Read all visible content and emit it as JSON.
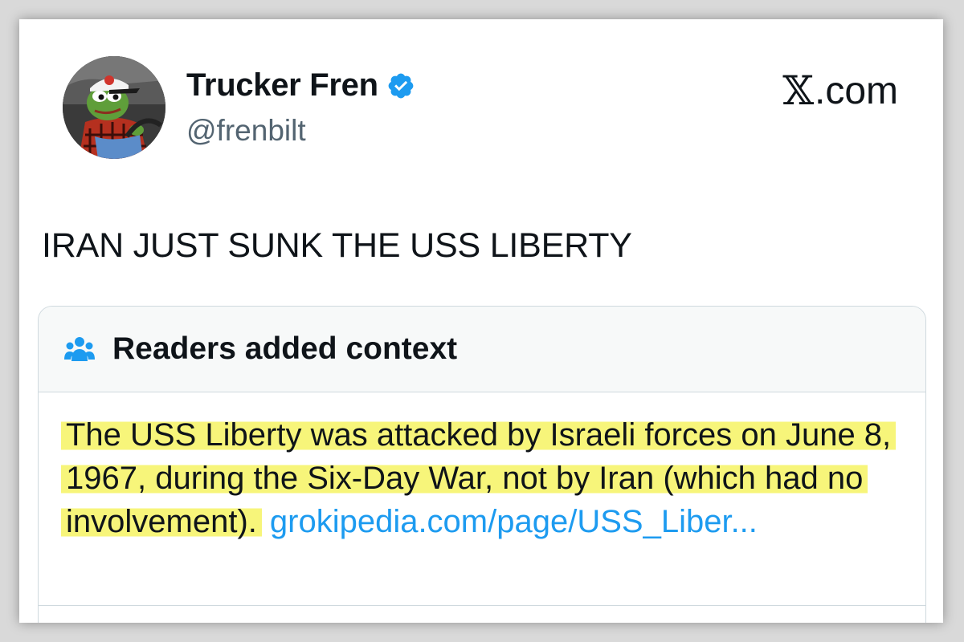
{
  "author": {
    "display_name": "Trucker Fren",
    "handle": "@frenbilt",
    "verified": true
  },
  "brand": {
    "glyph": "𝕏",
    "label": ".com"
  },
  "post": {
    "text": "IRAN JUST SUNK THE USS LIBERTY"
  },
  "community_note": {
    "title": "Readers added context",
    "body": "The USS Liberty was attacked by Israeli forces on June 8, 1967, during the Six-Day War, not by Iran (which had no involvement).",
    "link_text": "grokipedia.com/page/USS_Liber..."
  },
  "colors": {
    "accent_blue": "#1d9bf0",
    "highlight_yellow": "#f7f57a",
    "text_primary": "#0f1419",
    "text_secondary": "#536471",
    "note_header_bg": "#f7f9f9",
    "border": "#cfd9de"
  },
  "icons": {
    "verified": "verified-badge-icon",
    "note": "people-group-icon",
    "avatar": "pepe-frog-avatar"
  }
}
